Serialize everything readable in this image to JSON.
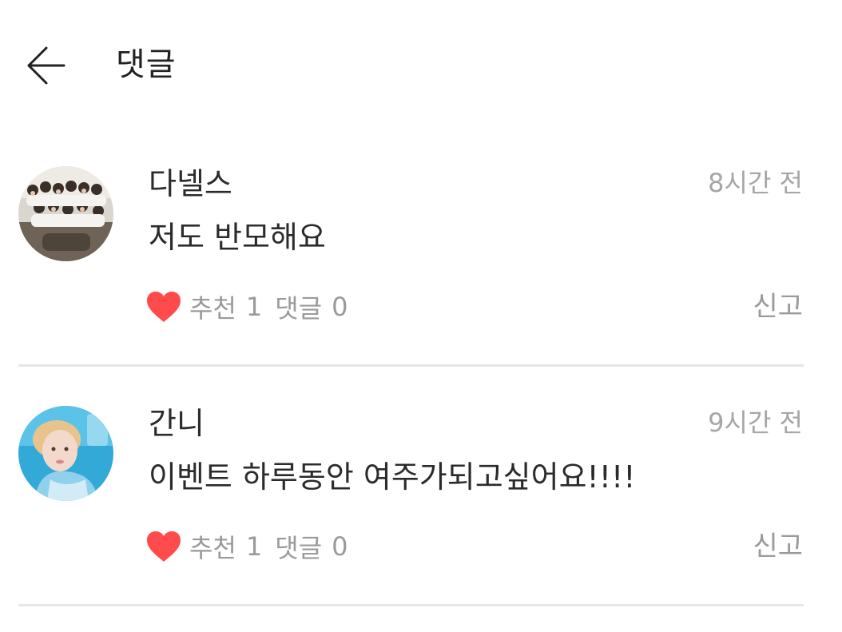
{
  "header": {
    "title": "댓글",
    "back_icon": "arrow-left-icon"
  },
  "colors": {
    "heart": "#ff4b4b",
    "text_primary": "#2b2b2b",
    "text_secondary": "#9a9a9a",
    "divider": "#e6e6e6"
  },
  "comments": [
    {
      "author": "다넬스",
      "time": "8시간 전",
      "text": "저도 반모해요",
      "like_label": "추천",
      "like_count": "1",
      "reply_label": "댓글",
      "reply_count": "0",
      "report_label": "신고",
      "like_icon": "heart-icon"
    },
    {
      "author": "간니",
      "time": "9시간 전",
      "text": "이벤트 하루동안 여주가되고싶어요!!!!",
      "like_label": "추천",
      "like_count": "1",
      "reply_label": "댓글",
      "reply_count": "0",
      "report_label": "신고",
      "like_icon": "heart-icon"
    }
  ]
}
